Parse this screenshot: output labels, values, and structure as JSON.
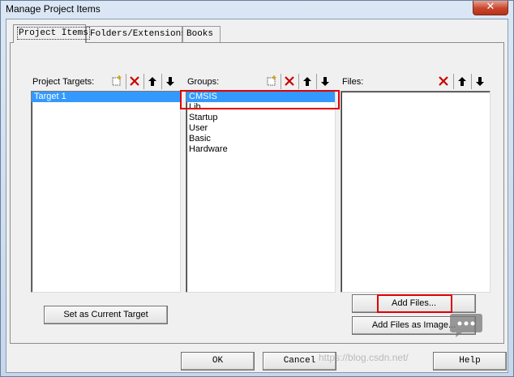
{
  "window": {
    "title": "Manage Project Items",
    "close_glyph": "✕"
  },
  "tabs": [
    {
      "label": "Project Items",
      "active": true
    },
    {
      "label": "Folders/Extensions",
      "active": false
    },
    {
      "label": "Books",
      "active": false
    }
  ],
  "targets": {
    "label": "Project Targets:",
    "items": [
      {
        "label": "Target 1",
        "selected": true
      }
    ],
    "toolbar": [
      "new-icon",
      "delete-icon",
      "move-up-icon",
      "move-down-icon"
    ]
  },
  "groups": {
    "label": "Groups:",
    "items": [
      {
        "label": "CMSIS",
        "selected": true
      },
      {
        "label": "Lib",
        "selected": false
      },
      {
        "label": "Startup",
        "selected": false
      },
      {
        "label": "User",
        "selected": false
      },
      {
        "label": "Basic",
        "selected": false
      },
      {
        "label": "Hardware",
        "selected": false
      }
    ],
    "toolbar": [
      "new-icon",
      "delete-icon",
      "move-up-icon",
      "move-down-icon"
    ]
  },
  "files": {
    "label": "Files:",
    "items": [],
    "toolbar": [
      "delete-icon",
      "move-up-icon",
      "move-down-icon"
    ]
  },
  "buttons": {
    "set_current_target": "Set as Current Target",
    "add_files": "Add Files...",
    "add_files_image": "Add Files as Image...",
    "ok": "OK",
    "cancel": "Cancel",
    "help": "Help"
  },
  "watermark": "https://blog.csdn.net/",
  "colors": {
    "selection": "#3399ff",
    "highlight_box": "#e00000",
    "delete_icon": "#cc0000"
  }
}
